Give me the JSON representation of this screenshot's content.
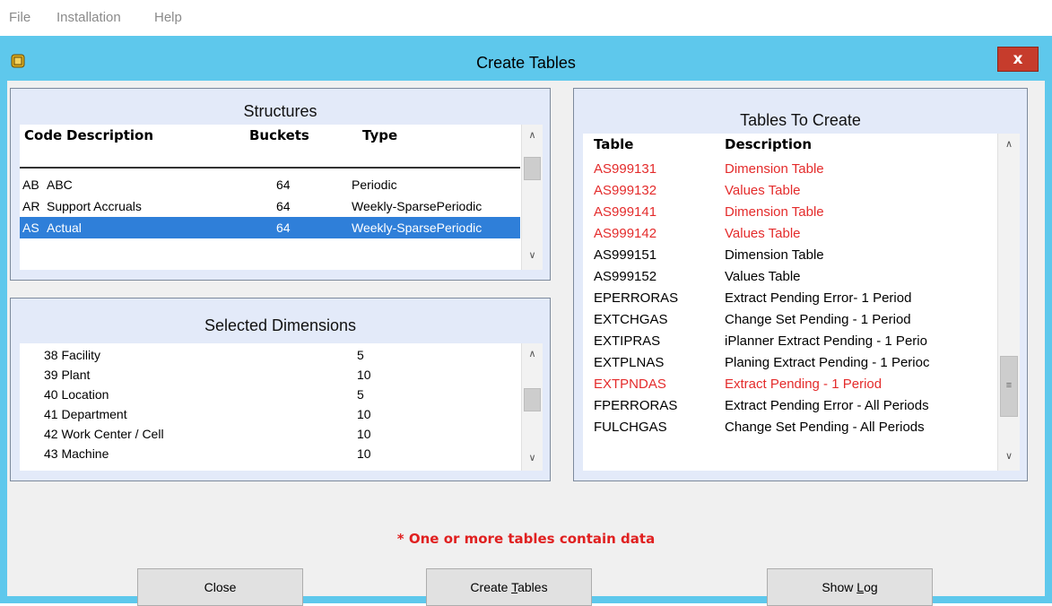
{
  "menu": {
    "file": "File",
    "installation": "Installation",
    "help": "Help"
  },
  "window": {
    "title": "Create Tables",
    "close_label": "x"
  },
  "structures": {
    "title": "Structures",
    "headers": {
      "code": "Code",
      "description": "Description",
      "buckets": "Buckets",
      "type": "Type"
    },
    "rows": [
      {
        "code": "AB",
        "description": "ABC",
        "buckets": "64",
        "type": "Periodic"
      },
      {
        "code": "AR",
        "description": "Support Accruals",
        "buckets": "64",
        "type": "Weekly-SparsePeriodic"
      },
      {
        "code": "AS",
        "description": "Actual",
        "buckets": "64",
        "type": "Weekly-SparsePeriodic"
      }
    ]
  },
  "dimensions": {
    "title": "Selected Dimensions",
    "rows": [
      {
        "name": "38 Facility",
        "value": "5"
      },
      {
        "name": "39 Plant",
        "value": "10"
      },
      {
        "name": "40 Location",
        "value": "5"
      },
      {
        "name": "41 Department",
        "value": "10"
      },
      {
        "name": "42 Work Center / Cell",
        "value": "10"
      },
      {
        "name": "43 Machine",
        "value": "10"
      }
    ]
  },
  "tables": {
    "title": "Tables To Create",
    "headers": {
      "table": "Table",
      "description": "Description"
    },
    "rows": [
      {
        "table": "AS999131",
        "description": "Dimension Table"
      },
      {
        "table": "AS999132",
        "description": "Values Table"
      },
      {
        "table": "AS999141",
        "description": "Dimension Table"
      },
      {
        "table": "AS999142",
        "description": "Values Table"
      },
      {
        "table": "AS999151",
        "description": "Dimension Table"
      },
      {
        "table": "AS999152",
        "description": "Values Table"
      },
      {
        "table": "EPERRORAS",
        "description": "Extract Pending Error- 1 Period"
      },
      {
        "table": "EXTCHGAS",
        "description": "Change Set Pending - 1 Period"
      },
      {
        "table": "EXTIPRAS",
        "description": "iPlanner Extract Pending - 1 Perio"
      },
      {
        "table": "EXTPLNAS",
        "description": "Planing Extract Pending - 1 Perioc"
      },
      {
        "table": "EXTPNDAS",
        "description": "Extract Pending - 1 Period"
      },
      {
        "table": "FPERRORAS",
        "description": "Extract Pending Error - All Periods"
      },
      {
        "table": "FULCHGAS",
        "description": "Change Set Pending - All Periods"
      }
    ]
  },
  "warning": "* One or more tables contain data",
  "buttons": {
    "close": "Close",
    "create_pre": "Create ",
    "create_u": "T",
    "create_post": "ables",
    "log_pre": "Show ",
    "log_u": "L",
    "log_post": "og"
  },
  "colors": {
    "titlebar": "#5ec8ec",
    "selection": "#2f7fd9",
    "data_row": "#e42b2b",
    "close_button": "#c63c2c"
  }
}
